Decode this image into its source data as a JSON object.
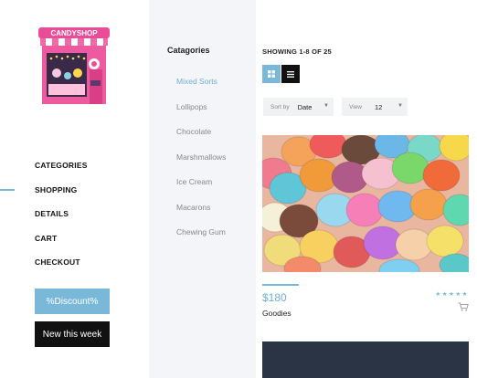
{
  "logo": {
    "text": "CANDYSHOP"
  },
  "nav": {
    "items": [
      "CATEGORIES",
      "SHOPPING",
      "DETAILS",
      "CART",
      "CHECKOUT"
    ]
  },
  "buttons": {
    "discount": "%Discount%",
    "new": "New this week"
  },
  "categories": {
    "title": "Catagories",
    "items": [
      "Mixed Sorts",
      "Lollipops",
      "Chocolate",
      "Marshmallows",
      "Ice Cream",
      "Macarons",
      "Chewing Gum"
    ]
  },
  "listing": {
    "showing": "SHOWING 1-8 OF 25",
    "sort_label": "Sort by",
    "sort_value": "Date",
    "view_label": "View",
    "view_value": "12"
  },
  "product": {
    "price": "$180",
    "name": "Goodies",
    "rating_stars": 5
  },
  "colors": {
    "accent": "#7ab8d9",
    "dark": "#111111",
    "sidebar_bg": "#f3f5f8"
  }
}
